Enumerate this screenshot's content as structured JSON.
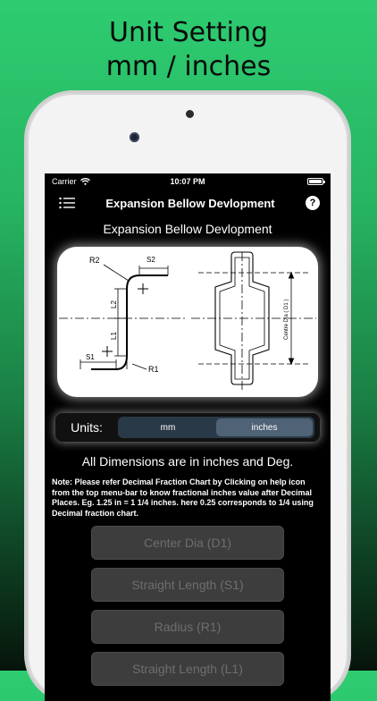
{
  "headline": {
    "line1": "Unit Setting",
    "line2": "mm / inches"
  },
  "status": {
    "carrier": "Carrier",
    "time": "10:07 PM"
  },
  "nav": {
    "title": "Expansion Bellow Devlopment",
    "help": "?"
  },
  "section_title": "Expansion Bellow Devlopment",
  "diagram_labels": {
    "r2": "R2",
    "s2": "S2",
    "l2": "L2",
    "l1": "L1",
    "s1": "S1",
    "r1": "R1",
    "centre_dia": "Centre Dia ( D1 )"
  },
  "units": {
    "label": "Units:",
    "options": [
      "mm",
      "inches"
    ],
    "selected": "inches"
  },
  "dims_note": "All Dimensions are in inches and Deg.",
  "help_note": "Note: Please refer Decimal Fraction Chart by Clicking on help icon from the top menu-bar to know fractional inches value after Decimal Places. Eg. 1.25 in = 1 1/4 inches. here 0.25 corresponds to 1/4 using Decimal fraction chart.",
  "fields": [
    {
      "placeholder": "Center Dia (D1)"
    },
    {
      "placeholder": "Straight Length (S1)"
    },
    {
      "placeholder": "Radius (R1)"
    },
    {
      "placeholder": "Straight Length (L1)"
    }
  ]
}
